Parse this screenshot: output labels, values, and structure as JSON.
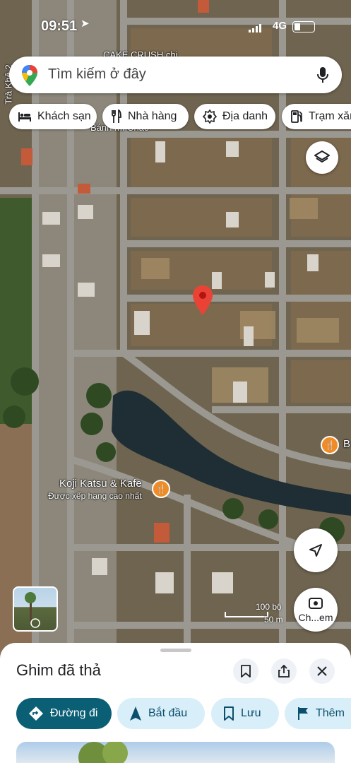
{
  "status_bar": {
    "time": "09:51",
    "network": "4G"
  },
  "search": {
    "placeholder": "Tìm kiếm ở đây"
  },
  "chips": [
    {
      "label": "Khách sạn",
      "icon": "bed-icon"
    },
    {
      "label": "Nhà hàng",
      "icon": "restaurant-icon"
    },
    {
      "label": "Địa danh",
      "icon": "landmark-icon"
    },
    {
      "label": "Trạm xăn",
      "icon": "gas-station-icon"
    }
  ],
  "map": {
    "street_label": "Trà Khê 2",
    "top_place_label": "CAKE CRUSH chi",
    "behind_chip_text": "Bánh mì Chảo",
    "place": {
      "name": "Koji Katsu & Kafe",
      "subtitle": "Được xếp hạng cao nhất"
    },
    "right_edge_place": "B",
    "scale": {
      "top": "100 bộ",
      "bottom": "50 m"
    },
    "street_view_label": "Ch...em"
  },
  "colors": {
    "pin": "#ea4335",
    "primary": "#0b5f75",
    "secondary_bg": "#d8eef8",
    "restaurant": "#f08c26"
  },
  "sheet": {
    "title": "Ghim đã thả",
    "actions": [
      {
        "label": "Đường đi",
        "icon": "directions-icon"
      },
      {
        "label": "Bắt đầu",
        "icon": "navigation-arrow-icon"
      },
      {
        "label": "Lưu",
        "icon": "bookmark-icon"
      },
      {
        "label": "Thêm",
        "icon": "flag-icon"
      }
    ]
  }
}
